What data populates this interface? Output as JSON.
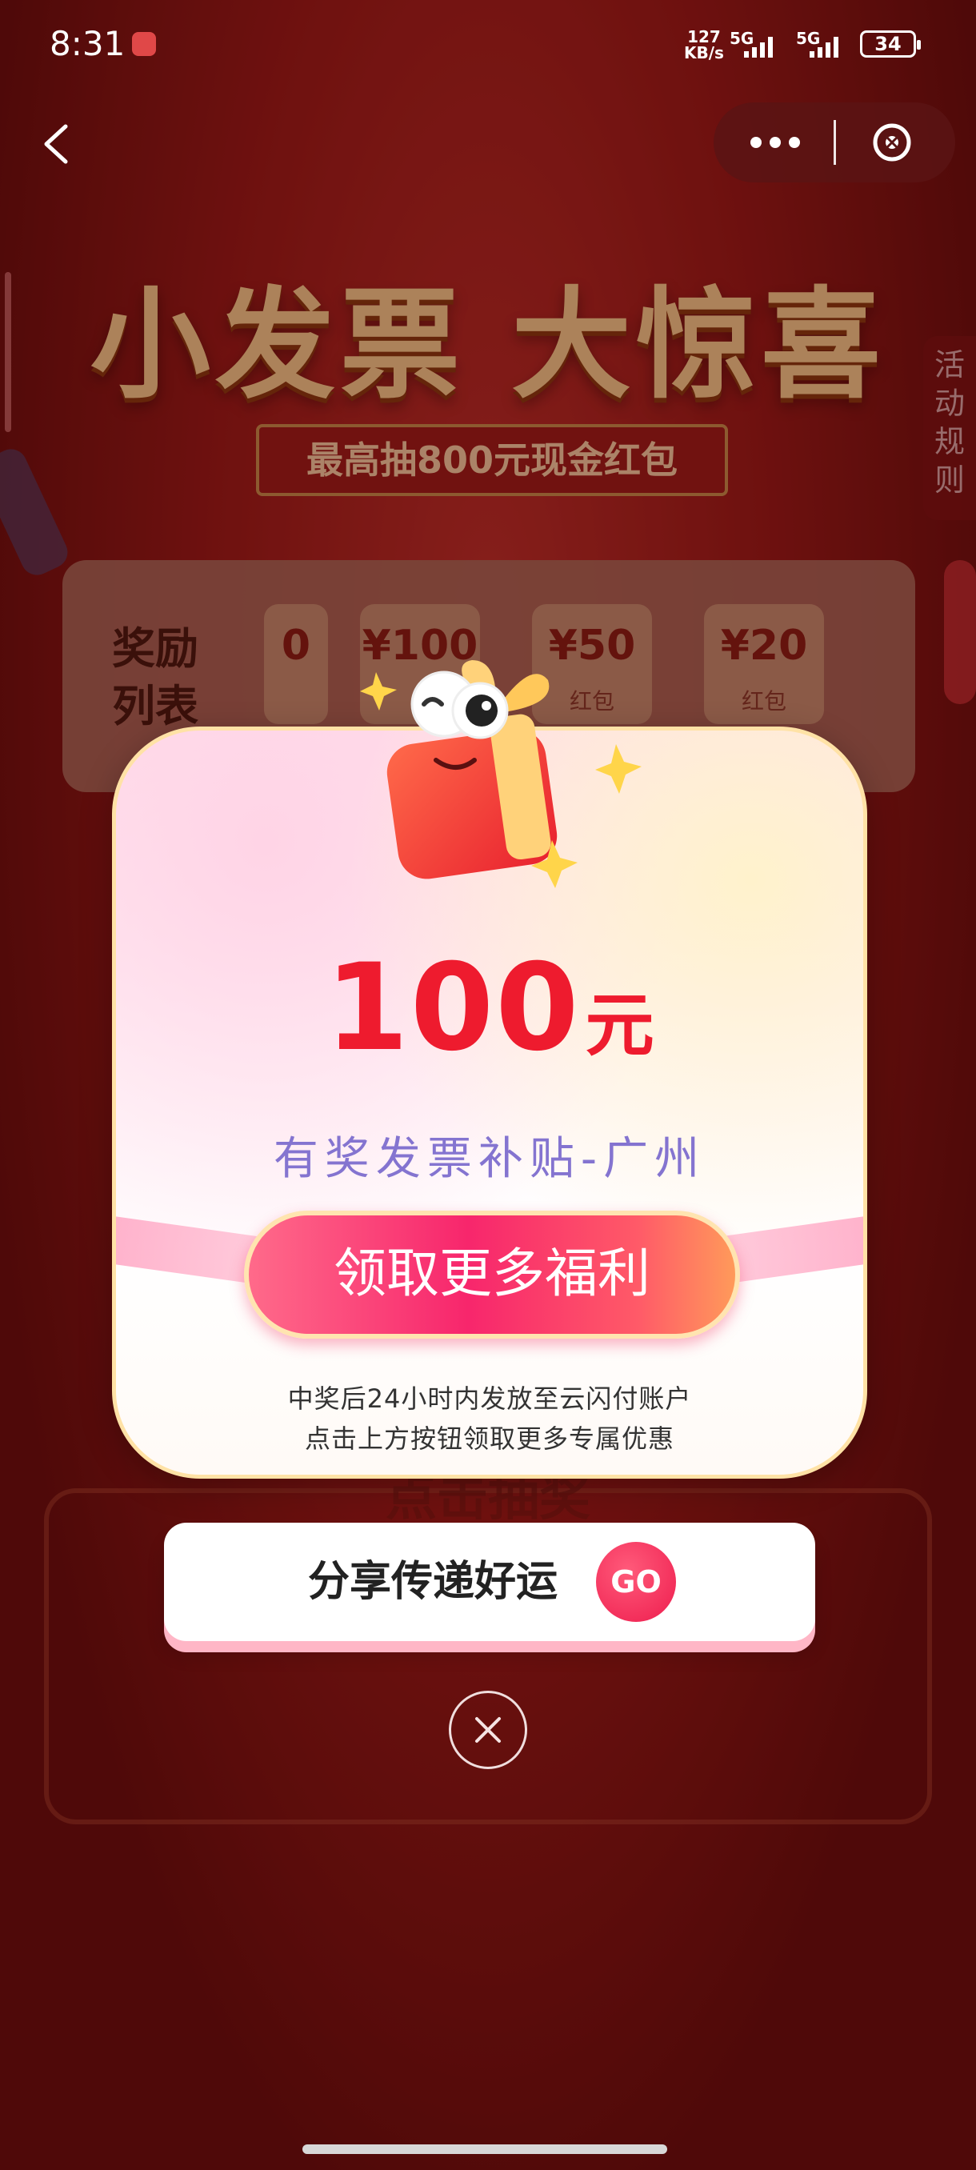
{
  "status_bar": {
    "time": "8:31",
    "speed_value": "127",
    "speed_unit": "KB/s",
    "network1": "5G",
    "network2": "5G",
    "battery": "34"
  },
  "background": {
    "title": "小发票 大惊喜",
    "subtitle": "最高抽800元现金红包",
    "rules_tab": [
      "活",
      "动",
      "规",
      "则"
    ],
    "reward_label_line1": "奖励",
    "reward_label_line2": "列表",
    "reward_items": [
      {
        "amount": "0",
        "label": ""
      },
      {
        "amount": "¥100",
        "label": ""
      },
      {
        "amount": "¥50",
        "label": "红包"
      },
      {
        "amount": "¥20",
        "label": "红包"
      }
    ],
    "draw_label": "点击抽奖"
  },
  "modal": {
    "amount": "100",
    "unit": "元",
    "description": "有奖发票补贴-广州",
    "claim_button": "领取更多福利",
    "note_line1": "中奖后24小时内发放至云闪付账户",
    "note_line2": "点击上方按钮领取更多专属优惠"
  },
  "share": {
    "label": "分享传递好运",
    "go": "GO"
  },
  "colors": {
    "accent_red": "#ee1b2e",
    "description_purple": "#8474d0",
    "button_pink": "#f7266c"
  },
  "icons": {
    "back": "chevron-left-icon",
    "more": "more-dots-icon",
    "close_mini": "close-circle-icon",
    "close_modal": "close-icon"
  }
}
